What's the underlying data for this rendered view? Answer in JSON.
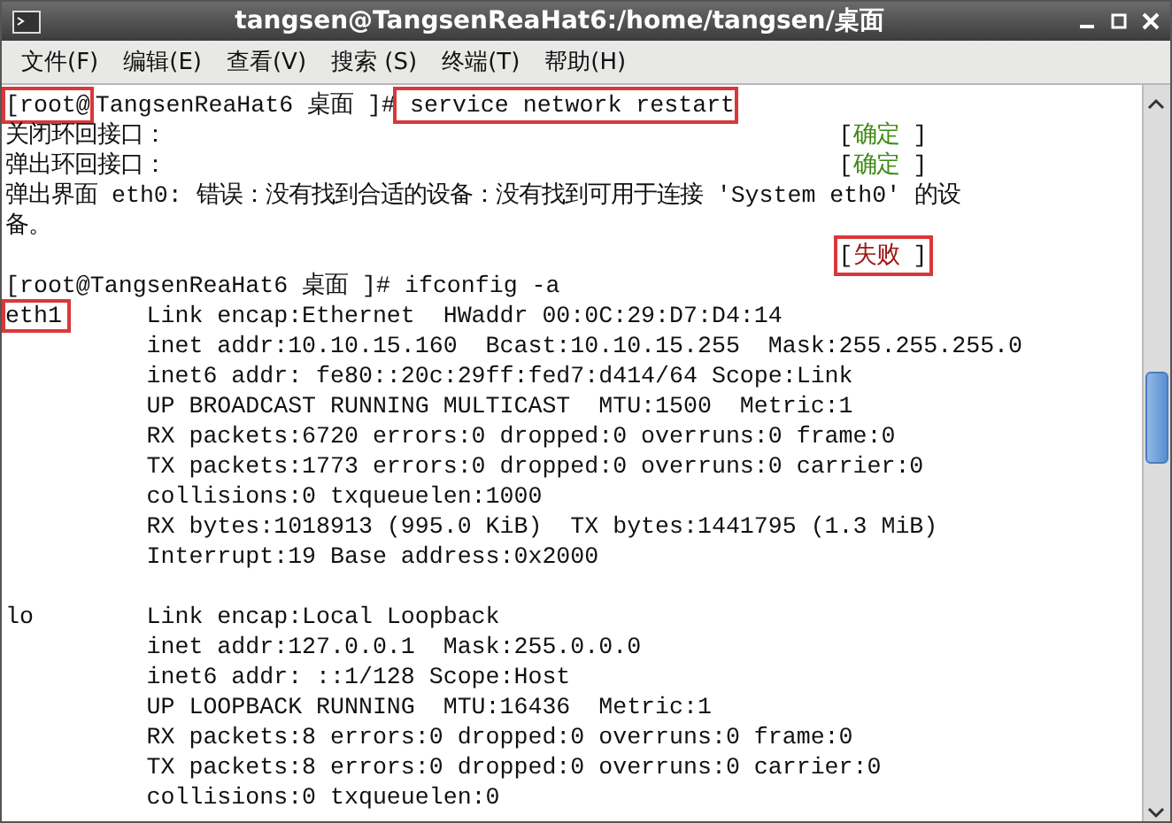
{
  "window": {
    "title": "tangsen@TangsenReaHat6:/home/tangsen/桌面"
  },
  "menu": [
    "文件(F)",
    "编辑(E)",
    "查看(V)",
    "搜索 (S)",
    "终端(T)",
    "帮助(H)"
  ],
  "terminal": {
    "lines": [
      {
        "kind": "command",
        "segments": [
          {
            "text": "[root@",
            "highlighted": true
          },
          {
            "text": "TangsenReaHat6 桌面 ]#",
            "highlighted": false
          },
          {
            "text": " service network restart",
            "highlighted": true
          }
        ]
      },
      {
        "kind": "status",
        "text": "关闭环回接口：",
        "open": "[",
        "word": "确定",
        "close": "]",
        "color": "#3d8a14",
        "highlighted": false
      },
      {
        "kind": "status",
        "text": "弹出环回接口：",
        "open": "[",
        "word": "确定",
        "close": "]",
        "color": "#3d8a14",
        "highlighted": false
      },
      {
        "kind": "text",
        "text": "弹出界面 eth0: 错误：没有找到合适的设备：没有找到可用于连接 'System eth0' 的设"
      },
      {
        "kind": "text",
        "text": "备。"
      },
      {
        "kind": "status",
        "open": "[",
        "word": "失败",
        "close": "]",
        "color": "#a01818",
        "highlighted": true
      },
      {
        "kind": "command",
        "segments": [
          {
            "text": "[root@TangsenReaHat6 桌面 ]# ifconfig -a",
            "highlighted": false
          }
        ]
      },
      {
        "kind": "iface",
        "name": "eth1",
        "highlighted": true,
        "text": "Link encap:Ethernet  HWaddr 00:0C:29:D7:D4:14"
      },
      {
        "kind": "detail",
        "text": "inet addr:10.10.15.160  Bcast:10.10.15.255  Mask:255.255.255.0"
      },
      {
        "kind": "detail",
        "text": "inet6 addr: fe80::20c:29ff:fed7:d414/64 Scope:Link"
      },
      {
        "kind": "detail",
        "text": "UP BROADCAST RUNNING MULTICAST  MTU:1500  Metric:1"
      },
      {
        "kind": "detail",
        "text": "RX packets:6720 errors:0 dropped:0 overruns:0 frame:0"
      },
      {
        "kind": "detail",
        "text": "TX packets:1773 errors:0 dropped:0 overruns:0 carrier:0"
      },
      {
        "kind": "detail",
        "text": "collisions:0 txqueuelen:1000"
      },
      {
        "kind": "detail",
        "text": "RX bytes:1018913 (995.0 KiB)  TX bytes:1441795 (1.3 MiB)"
      },
      {
        "kind": "detail",
        "text": "Interrupt:19 Base address:0x2000"
      },
      {
        "kind": "blank"
      },
      {
        "kind": "iface",
        "name": "lo",
        "highlighted": false,
        "text": "Link encap:Local Loopback"
      },
      {
        "kind": "detail",
        "text": "inet addr:127.0.0.1  Mask:255.0.0.0"
      },
      {
        "kind": "detail",
        "text": "inet6 addr: ::1/128 Scope:Host"
      },
      {
        "kind": "detail",
        "text": "UP LOOPBACK RUNNING  MTU:16436  Metric:1"
      },
      {
        "kind": "detail",
        "text": "RX packets:8 errors:0 dropped:0 overruns:0 frame:0"
      },
      {
        "kind": "detail",
        "text": "TX packets:8 errors:0 dropped:0 overruns:0 carrier:0"
      },
      {
        "kind": "detail",
        "text": "collisions:0 txqueuelen:0"
      }
    ]
  }
}
